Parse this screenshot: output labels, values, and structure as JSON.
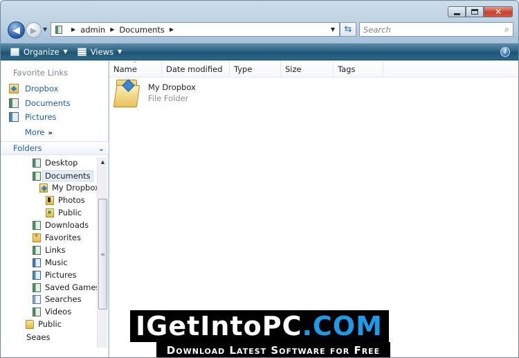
{
  "window": {
    "caption": {
      "minimize": "",
      "maximize": "",
      "close": "✕"
    }
  },
  "nav": {
    "back_glyph": "◀",
    "forward_glyph": "▶",
    "dropdown_glyph": "▼"
  },
  "address": {
    "crumbs": [
      "admin",
      "Documents"
    ],
    "separator": "▶",
    "dropdown": "▼"
  },
  "refresh_glyph": "⇆",
  "search": {
    "placeholder": "Search",
    "icon": "magnifier-icon"
  },
  "command_bar": {
    "organize_label": "Organize",
    "views_label": "Views",
    "caret": "▼",
    "help": "?"
  },
  "favorite_links": {
    "header": "Favorite Links",
    "items": [
      "Dropbox",
      "Documents",
      "Pictures"
    ],
    "more_label": "More",
    "more_chevron": "»"
  },
  "folders": {
    "header": "Folders",
    "chevron": "⌄",
    "tree": [
      "Desktop",
      "Documents",
      "My Dropbox",
      "Photos",
      "Public",
      "Downloads",
      "Favorites",
      "Links",
      "Music",
      "Pictures",
      "Saved Games",
      "Searches",
      "Videos",
      "Public",
      "Seaes"
    ],
    "scroll_up": "▲",
    "scroll_grip": "≡"
  },
  "columns": [
    "Name",
    "Date modified",
    "Type",
    "Size",
    "Tags"
  ],
  "sort_indicator": "^",
  "files": [
    {
      "name": "My Dropbox",
      "type": "File Folder"
    }
  ],
  "watermark": {
    "brand_main": "IGetIntoPC",
    "brand_dot": ".",
    "brand_tld": "COM",
    "tagline": "Download Latest Software for Free"
  },
  "colors": {
    "command_bar": "#2f6584",
    "link_blue": "#1f5f9d",
    "watermark_accent": "#1e9be8"
  }
}
